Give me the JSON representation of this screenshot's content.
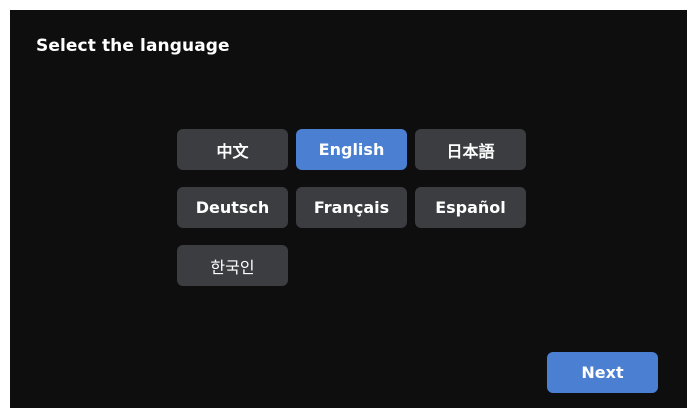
{
  "header": {
    "title": "Select the language"
  },
  "languages": [
    {
      "label": "中文",
      "selected": false
    },
    {
      "label": "English",
      "selected": true
    },
    {
      "label": "日本語",
      "selected": false
    },
    {
      "label": "Deutsch",
      "selected": false
    },
    {
      "label": "Français",
      "selected": false
    },
    {
      "label": "Español",
      "selected": false
    },
    {
      "label": "한국인",
      "selected": false
    }
  ],
  "footer": {
    "next_label": "Next"
  },
  "colors": {
    "background": "#0e0e0e",
    "button": "#3c3d41",
    "accent": "#4a7fd1",
    "text": "#ffffff"
  }
}
